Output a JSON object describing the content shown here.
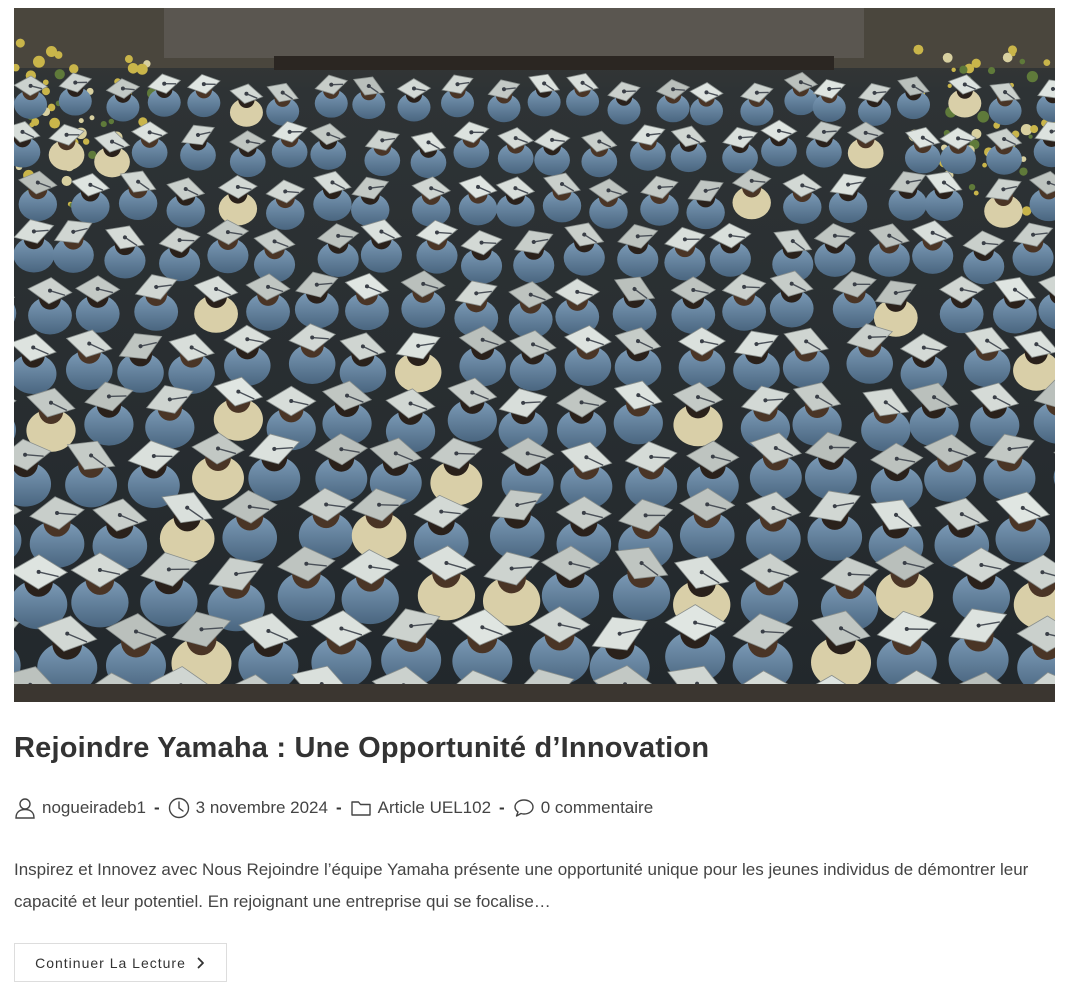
{
  "post": {
    "image_alt": "Graduation ceremony with rows of graduates in blue gowns and grey caps",
    "title": "Rejoindre Yamaha : Une Opportunité d’Innovation",
    "meta": {
      "author": "nogueiradeb1",
      "date": "3 novembre 2024",
      "category": "Article UEL102",
      "comments": "0 commentaire",
      "separator": "-",
      "icons": {
        "author": "user-icon",
        "date": "clock-icon",
        "category": "folder-icon",
        "comments": "comment-icon"
      }
    },
    "excerpt": "Inspirez et Innovez avec Nous Rejoindre l’équipe Yamaha présente une opportunité unique pour les jeunes individus de démontrer leur capacité et leur potentiel. En rejoignant une entreprise qui se focalise…",
    "read_more_label": "Continuer La Lecture",
    "read_more_icon": "chevron-right-icon"
  },
  "colors": {
    "text": "#333333",
    "meta_text": "#444444",
    "button_border": "#dddddd",
    "gown_blue": "#6e8fab",
    "cap_grey": "#c9d0cd"
  }
}
